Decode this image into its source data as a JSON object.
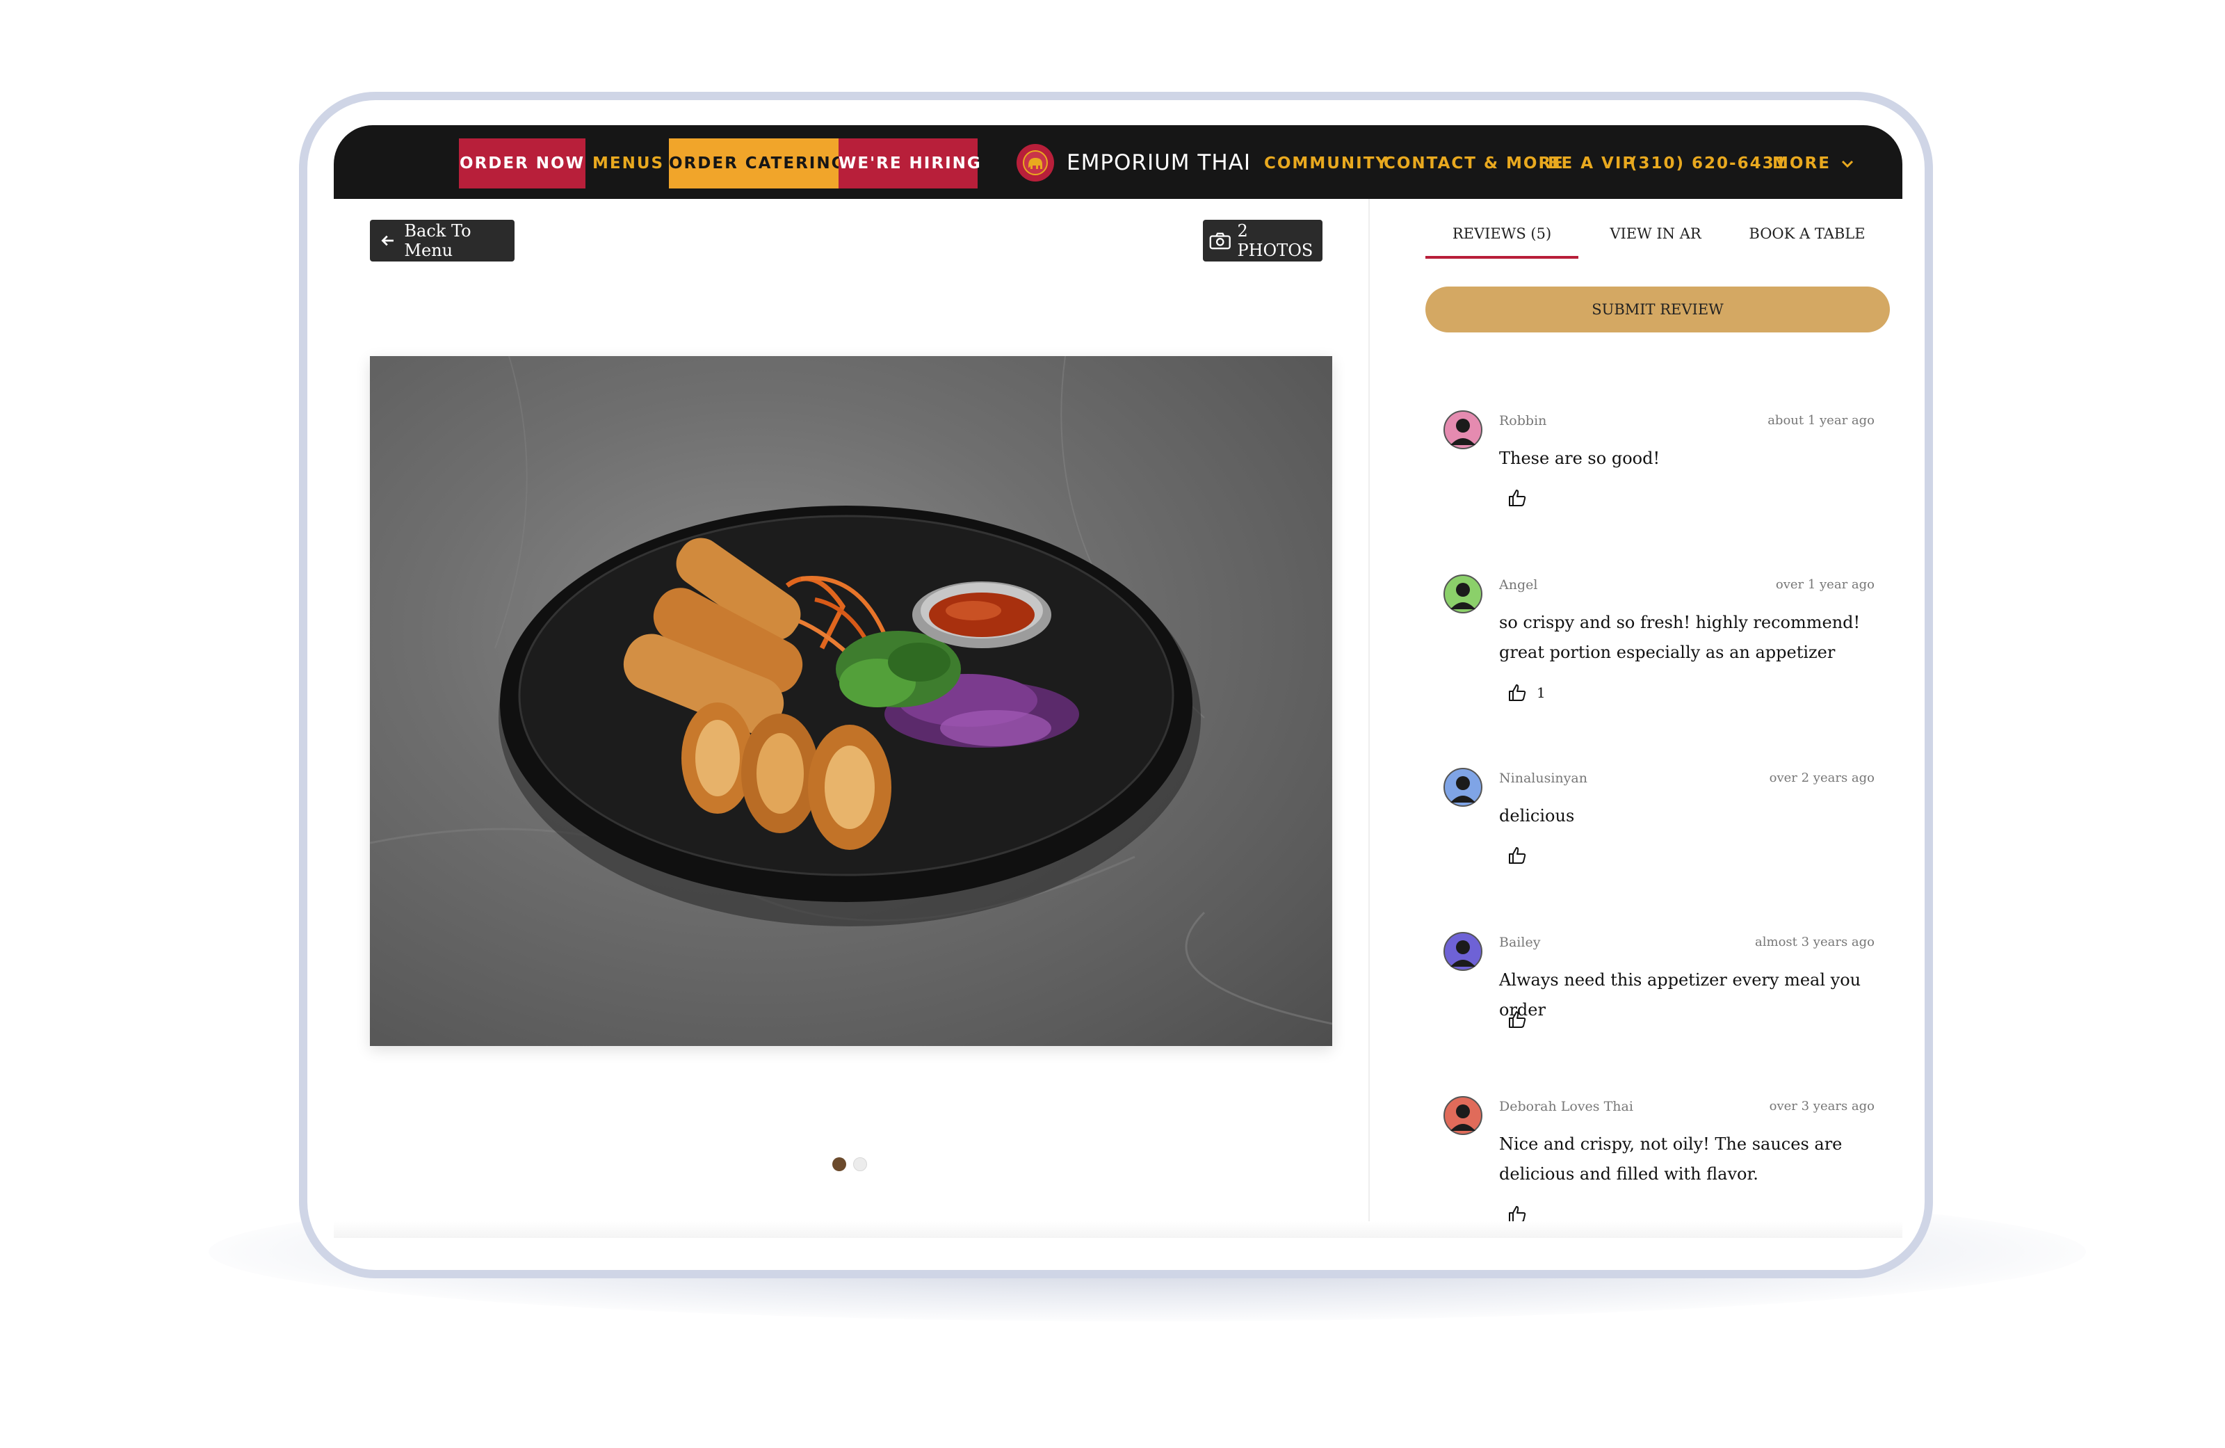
{
  "nav": {
    "order_now": "ORDER NOW",
    "menus": "MENUS",
    "order_catering": "ORDER CATERING",
    "hiring": "WE'RE HIRING",
    "brand": "EMPORIUM THAI",
    "community": "COMMUNITY",
    "contact": "CONTACT & MORE",
    "vip": "BE A VIP",
    "phone": "(310) 620-6431",
    "more": "MORE"
  },
  "left": {
    "back_label": "Back To Menu",
    "photos_label": "2 PHOTOS",
    "carousel": {
      "total": 2,
      "active": 1
    }
  },
  "tabs": [
    {
      "label": "REVIEWS (5)",
      "active": true
    },
    {
      "label": "VIEW IN AR",
      "active": false
    },
    {
      "label": "BOOK A TABLE",
      "active": false
    }
  ],
  "submit_label": "SUBMIT REVIEW",
  "reviews": [
    {
      "name": "Robbin",
      "time": "about 1 year ago",
      "text": "These are so good!",
      "likes": "",
      "avatar_color": "#e58bb0"
    },
    {
      "name": "Angel",
      "time": "over 1 year ago",
      "text": "so crispy and so fresh! highly recommend! great portion especially as an appetizer",
      "likes": "1",
      "avatar_color": "#8bd06a"
    },
    {
      "name": "Ninalusinyan",
      "time": "over 2 years ago",
      "text": "delicious",
      "likes": "",
      "avatar_color": "#7fa4e6"
    },
    {
      "name": "Bailey",
      "time": "almost 3 years ago",
      "text": "Always need this appetizer every meal you order",
      "likes": "",
      "avatar_color": "#6e62d6"
    },
    {
      "name": "Deborah Loves Thai",
      "time": "over 3 years ago",
      "text": "Nice and crispy, not oily! The sauces are delicious and filled with flavor.",
      "likes": "",
      "avatar_color": "#e06b5a"
    }
  ],
  "colors": {
    "brand_red": "#b81f3a",
    "brand_yellow": "#f1a52a",
    "gold": "#e9a91f",
    "submit": "#d4a863",
    "dot_active": "#6b4a2c"
  }
}
